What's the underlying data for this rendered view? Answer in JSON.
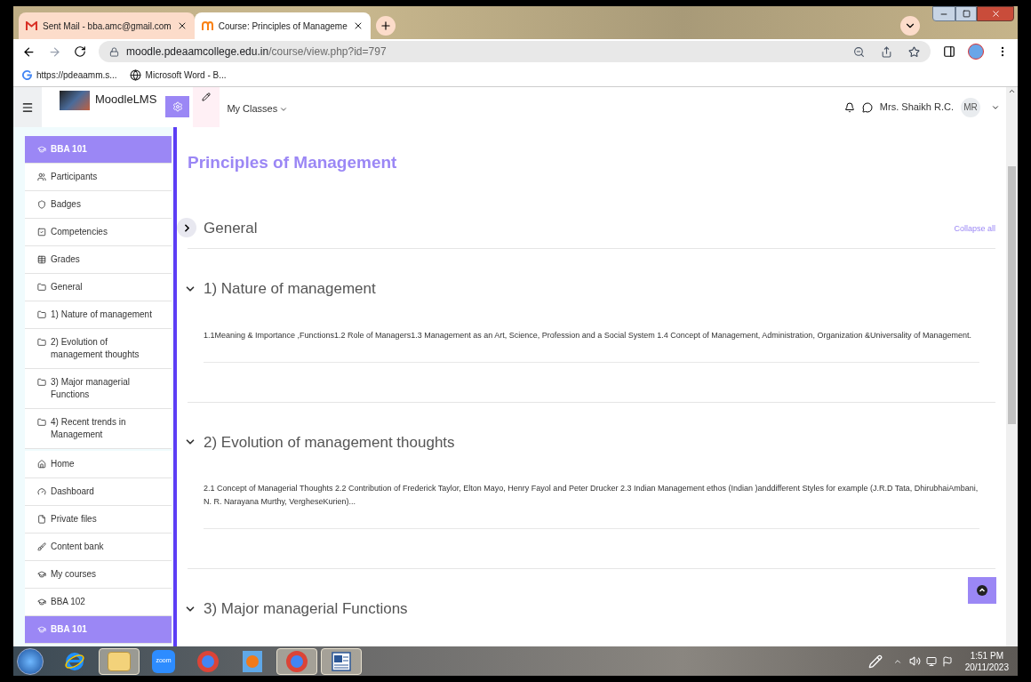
{
  "browser": {
    "tabs": [
      {
        "title": "Sent Mail - bba.amc@gmail.com",
        "kind": "mail",
        "selected": false
      },
      {
        "title": "Course: Principles of Manageme",
        "kind": "moodle",
        "selected": true
      }
    ],
    "address": {
      "host": "moodle.pdeaamcollege.edu.in",
      "path": "/course/view.php?id=797"
    },
    "bookmarks": [
      {
        "label": "https://pdeaamm.s...",
        "kind": "google"
      },
      {
        "label": "Microsoft Word - B...",
        "kind": "globe"
      }
    ]
  },
  "navbar": {
    "site_name": "MoodleLMS",
    "menu": "My Classes",
    "user_name": "Mrs. Shaikh R.C.",
    "avatar_initials": "MR"
  },
  "sidebar": {
    "groups": [
      {
        "items": [
          {
            "label": "BBA 101",
            "kind": "cap",
            "selected": true
          },
          {
            "label": "Participants",
            "kind": "users",
            "selected": false
          },
          {
            "label": "Badges",
            "kind": "shield",
            "selected": false
          },
          {
            "label": "Competencies",
            "kind": "check",
            "selected": false
          },
          {
            "label": "Grades",
            "kind": "table",
            "selected": false
          },
          {
            "label": "General",
            "kind": "folder",
            "selected": false
          },
          {
            "label": "1) Nature of management",
            "kind": "folder",
            "selected": false
          },
          {
            "label": "2) Evolution of management thoughts",
            "kind": "folder",
            "selected": false
          },
          {
            "label": "3) Major managerial Functions",
            "kind": "folder",
            "selected": false
          },
          {
            "label": "4) Recent trends in Management",
            "kind": "folder",
            "selected": false
          }
        ]
      },
      {
        "items": [
          {
            "label": "Home",
            "kind": "home",
            "selected": false
          },
          {
            "label": "Dashboard",
            "kind": "gauge",
            "selected": false
          },
          {
            "label": "Private files",
            "kind": "file",
            "selected": false
          },
          {
            "label": "Content bank",
            "kind": "brush",
            "selected": false
          },
          {
            "label": "My courses",
            "kind": "cap",
            "selected": false
          },
          {
            "label": "BBA 102",
            "kind": "cap",
            "selected": false
          },
          {
            "label": "BBA 101",
            "kind": "cap",
            "selected": true
          }
        ]
      }
    ]
  },
  "course": {
    "title": "Principles of Management",
    "collapse_all": "Collapse all",
    "sections": [
      {
        "title": "General",
        "expanded": false
      },
      {
        "title": "1) Nature of management",
        "expanded": true,
        "summary": "1.1Meaning & Importance ,Functions1.2 Role of Managers1.3 Management as an Art, Science, Profession and a Social System 1.4 Concept of Management, Administration, Organization &Universality of Management."
      },
      {
        "title": "2) Evolution of management thoughts",
        "expanded": true,
        "summary": "2.1 Concept of Managerial Thoughts 2.2 Contribution of Frederick Taylor, Elton Mayo, Henry Fayol and Peter Drucker 2.3 Indian Management ethos (Indian )anddifferent Styles for example (J.R.D Tata, DhirubhaiAmbani, N. R. Narayana Murthy, VergheseKurien)..."
      },
      {
        "title": "3) Major managerial Functions",
        "expanded": true
      }
    ]
  },
  "taskbar": {
    "apps": [
      {
        "kind": "ie",
        "selected": false
      },
      {
        "kind": "folder",
        "selected": true
      },
      {
        "kind": "zoom",
        "label": "zoom",
        "selected": false
      },
      {
        "kind": "chrome",
        "selected": false
      },
      {
        "kind": "player",
        "selected": false
      },
      {
        "kind": "chrome",
        "selected": true
      },
      {
        "kind": "word",
        "selected": true
      }
    ],
    "time": "1:51 PM",
    "date": "20/11/2023"
  }
}
